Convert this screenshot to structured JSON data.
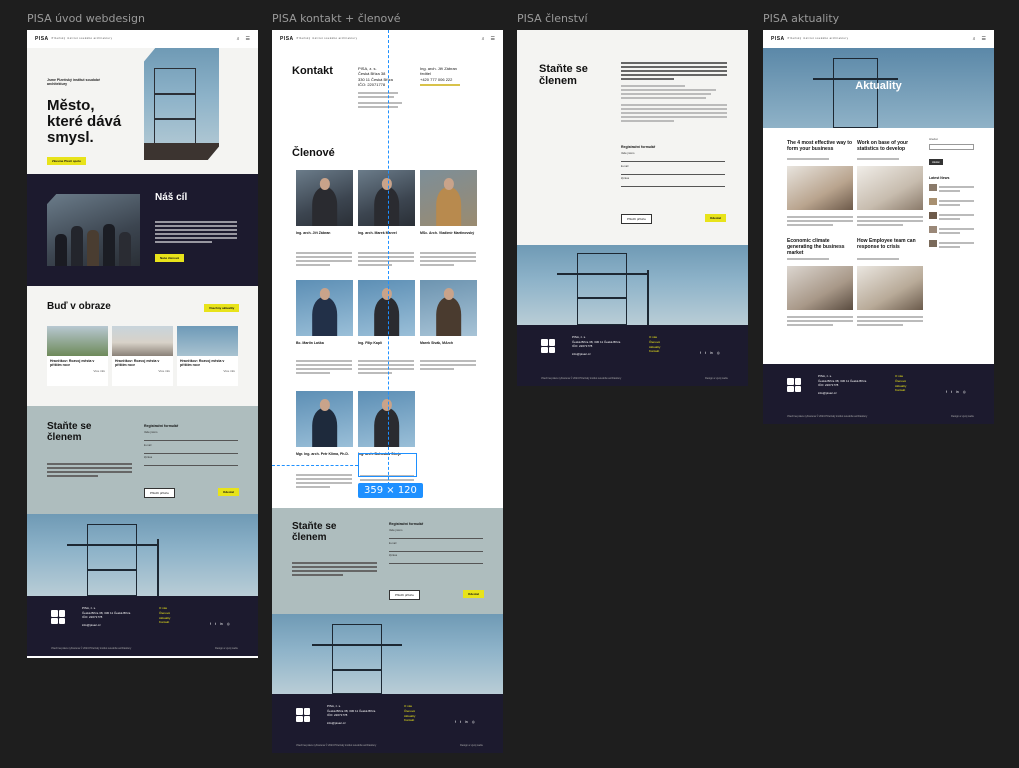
{
  "frames": [
    {
      "label": "PISA úvod webdesign"
    },
    {
      "label": "PISA kontakt + členové"
    },
    {
      "label": "PISA členství"
    },
    {
      "label": "PISA aktuality"
    }
  ],
  "common": {
    "logo": "PISA",
    "logo_sub": "Plzeňský institut soudobé architektury",
    "cta_join": "Staňte se členem",
    "reg_title": "Registrační formulář",
    "field_name": "Vaše jméno",
    "field_email": "E-mail",
    "field_phone": "Zpráva",
    "btn_attach": "Přiložit přílohu",
    "btn_send": "Odeslat",
    "footer_name": "PISA, z. s.",
    "footer_addr1": "Česká Bříza 38, 330 11 Česká Bříza",
    "footer_addr2": "IČO: 22071778",
    "footer_email": "info@pisaz.cz",
    "footer_links": [
      "O nás",
      "Členové",
      "Aktuality",
      "Kontakt"
    ],
    "footer_copy": "Všechna práva vyhrazena © 2024 Plzeňský institut soudobé architektury",
    "footer_credit": "Design a vývoj webu"
  },
  "home": {
    "hero_kicker": "Jsme Plzeňský institut soudobé architektury",
    "hero_title": "Město, které dává smysl.",
    "hero_btn": "Zkusme Plzeň spolu",
    "goal_title": "Náš cíl",
    "goal_btn": "Naše členové",
    "gallery_title": "Buď v obraze",
    "gallery_btn": "Všechny aktuality",
    "cards": [
      {
        "title": "Hravčíkov: Rozvoj města v příštím roce",
        "more": "Více info"
      },
      {
        "title": "Hravčíkov: Rozvoj města v příštím roce",
        "more": "Více info"
      },
      {
        "title": "Hravčíkov: Rozvoj města v příštím roce",
        "more": "Více info"
      }
    ],
    "join_title": "Staňte se členem"
  },
  "contact": {
    "title": "Kontakt",
    "org": "PISA, z. s.",
    "addr1": "Česká Bříza 38",
    "addr2": "330 11 Česká Bříza",
    "ico": "IČO: 22071778",
    "person": "Ing. arch. Jiří Zábran",
    "role": "ředitel",
    "phone": "+420 777 006 222",
    "members_title": "Členové",
    "members": [
      "Ing. arch. Jiří Zábran",
      "Ing. arch. Marek Marvel",
      "MSc. Arch. Vladimír Martinovský",
      "Bc. Martin Laška",
      "Ing. Filip Kaplí",
      "Marek Sivák, MArch",
      "Mgr. Ing. arch. Petr Klima, Ph.D.",
      "Ing. arch. Bohuslav Strejc"
    ],
    "selection_size": "359 × 120",
    "join_title": "Staňte se členem"
  },
  "membership": {
    "title": "Staňte se členem"
  },
  "news": {
    "hero_title": "Aktuality",
    "articles": [
      "The 4 most effective way to form your business",
      "Work on base of your statistics to develop",
      "Economic climate generating the business market",
      "How Employee team can response to crisis"
    ],
    "search_label": "Hledat",
    "search_btn": "Hledat",
    "latest_title": "Latest News"
  }
}
